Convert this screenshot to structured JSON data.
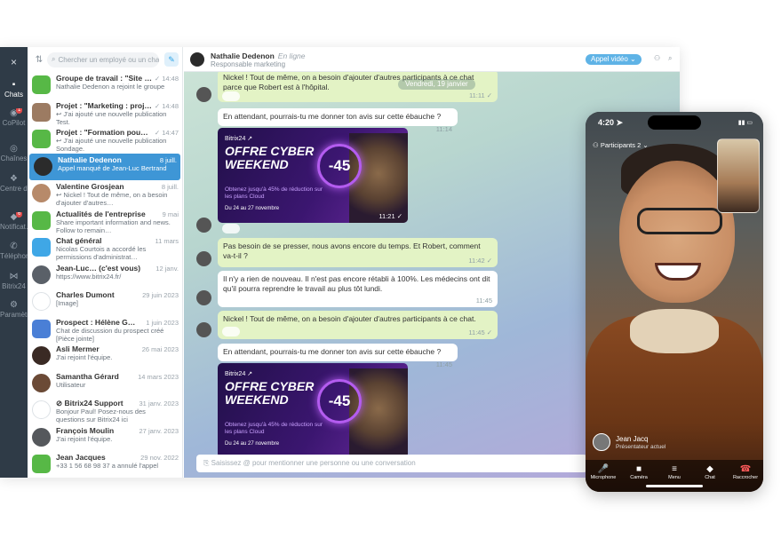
{
  "rail": {
    "close": "×",
    "items": [
      {
        "label": "Chats",
        "icon": "chat-icon",
        "glyph": "▪",
        "badge": ""
      },
      {
        "label": "CoPilot",
        "icon": "copilot-icon",
        "glyph": "◉",
        "badge": "1"
      },
      {
        "label": "Chaînes",
        "icon": "channels-icon",
        "glyph": "◎",
        "badge": ""
      },
      {
        "label": "Centre de…",
        "icon": "help-center-icon",
        "glyph": "❖",
        "badge": ""
      },
      {
        "label": "Notificat…",
        "icon": "bell-icon",
        "glyph": "◆",
        "badge": "6"
      },
      {
        "label": "Téléphonie",
        "icon": "phone-icon",
        "glyph": "✆",
        "badge": ""
      },
      {
        "label": "Bitrix24",
        "icon": "bitrix-icon",
        "glyph": "⋈",
        "badge": ""
      },
      {
        "label": "Paramètres",
        "icon": "gear-icon",
        "glyph": "⚙",
        "badge": ""
      }
    ]
  },
  "list": {
    "search_placeholder": "Chercher un employé ou un chat",
    "chats": [
      {
        "name": "Groupe de travail : \"Site …",
        "time": "✓ 14:48",
        "preview": "Nathalie Dedenon a rejoint le groupe",
        "color": "#57b846",
        "square": true
      },
      {
        "name": "Projet : \"Marketing : proj…",
        "time": "✓ 14:48",
        "preview": "↩ J'ai ajouté une nouvelle publication Test.",
        "color": "#9c7b62",
        "square": true
      },
      {
        "name": "Projet : \"Formation pou…",
        "time": "✓ 14:47",
        "preview": "↩ J'ai ajouté une nouvelle publication Sondage.",
        "color": "#57b846",
        "square": true
      },
      {
        "name": "Nathalie Dedenon",
        "time": "8 juill.",
        "preview": "Appel manqué de Jean-Luc Bertrand",
        "color": "#2b2b2b",
        "square": false
      },
      {
        "name": "Valentine Grosjean",
        "time": "8 juill.",
        "preview": "↩ Nickel ! Tout de même, on a besoin d'ajouter d'autres…",
        "color": "#b78a6a",
        "square": false
      },
      {
        "name": "Actualités de l'entreprise",
        "time": "9 mai",
        "preview": "Share important information and news. Follow to remain…",
        "color": "#57b846",
        "square": true
      },
      {
        "name": "Chat général",
        "time": "11 mars",
        "preview": "Nicolas Courtois a accordé les permissions d'administrat…",
        "color": "#3fa7e6",
        "square": true
      },
      {
        "name": "Jean-Luc… (c'est vous)",
        "time": "12 janv.",
        "preview": "https://www.bitrix24.fr/",
        "color": "#5a6068",
        "square": false
      },
      {
        "name": "Charles Dumont",
        "time": "29 juin 2023",
        "preview": "[Image]",
        "color": "#ffffff",
        "square": false
      },
      {
        "name": "Prospect : Hélène G…",
        "time": "1 juin 2023",
        "preview": "Chat de discussion du prospect créé [Pièce jointe]",
        "color": "#4a7fd6",
        "square": true
      },
      {
        "name": "Asli Mermer",
        "time": "26 mai 2023",
        "preview": "J'ai rejoint l'équipe.",
        "color": "#3a2a24",
        "square": false
      },
      {
        "name": "Samantha Gérard",
        "time": "14 mars 2023",
        "preview": "Utilisateur",
        "color": "#6b4a36",
        "square": false
      },
      {
        "name": "⊘ Bitrix24 Support",
        "time": "31 janv. 2023",
        "preview": "Bonjour Paul! Posez-nous des questions sur Bitrix24 ici",
        "color": "#ffffff",
        "square": false
      },
      {
        "name": "François Moulin",
        "time": "27 janv. 2023",
        "preview": "J'ai rejoint l'équipe.",
        "color": "#55585c",
        "square": false
      },
      {
        "name": "Jean Jacques",
        "time": "29 nov. 2022",
        "preview": "+33 1 56 68 98 37 a annulé l'appel",
        "color": "#57b846",
        "square": true
      }
    ]
  },
  "header": {
    "name": "Nathalie Dedenon",
    "status": "En ligne",
    "role": "Responsable marketing",
    "video_call": "Appel vidéo ⌄"
  },
  "feed": {
    "date_pill": "Vendredi, 19 janvier",
    "messages": [
      {
        "text": "Nickel ! Tout de même, on a besoin d'ajouter d'autres participants à ce chat parce que Robert est à l'hôpital.",
        "time": "11:11 ✓",
        "style": "g"
      },
      {
        "text": "En attendant, pourrais-tu me donner ton avis sur cette ébauche ?",
        "time": "11:14",
        "style": "w"
      },
      {
        "text": "Pas besoin de se presser, nous avons encore du temps. Et Robert, comment va-t-il ?",
        "time": "11:42 ✓",
        "style": "g"
      },
      {
        "text": "Il n'y a rien de nouveau. Il n'est pas encore rétabli à 100%. Les médecins ont dit qu'il pourra reprendre le travail au plus tôt lundi.",
        "time": "11:45",
        "style": "w"
      },
      {
        "text": "Nickel ! Tout de même, on a besoin d'ajouter d'autres participants à ce chat.",
        "time": "11:45 ✓",
        "style": "g"
      },
      {
        "text": "En attendant, pourrais-tu me donner ton avis sur cette ébauche ?",
        "time": "11:45",
        "style": "w"
      }
    ],
    "banner": {
      "brand": "Bitrix24 ↗",
      "title": "OFFRE CYBER WEEKEND",
      "subtitle": "Obtenez jusqu'à 45% de réduction sur les plans Cloud",
      "dates": "Du 24 au 27 novembre",
      "badge": "-45",
      "time1": "11:21 ✓",
      "time2": ""
    },
    "composer_placeholder": "Saisissez @ pour mentionner une personne ou une conversation"
  },
  "phone": {
    "time": "4:20 ➤",
    "participants": "Participants 2 ⌄",
    "caller_name": "Jean Jacq",
    "caller_role": "Présentateur actuel",
    "buttons": [
      {
        "label": "Microphone",
        "icon": "microphone-icon",
        "glyph": "🎤",
        "red": false
      },
      {
        "label": "Caméra",
        "icon": "camera-icon",
        "glyph": "■",
        "red": false
      },
      {
        "label": "Menu",
        "icon": "menu-icon",
        "glyph": "≡",
        "red": false
      },
      {
        "label": "Chat",
        "icon": "chat-bubble-icon",
        "glyph": "◆",
        "red": false
      },
      {
        "label": "Raccrocher",
        "icon": "hang-up-icon",
        "glyph": "☎",
        "red": true
      }
    ]
  }
}
